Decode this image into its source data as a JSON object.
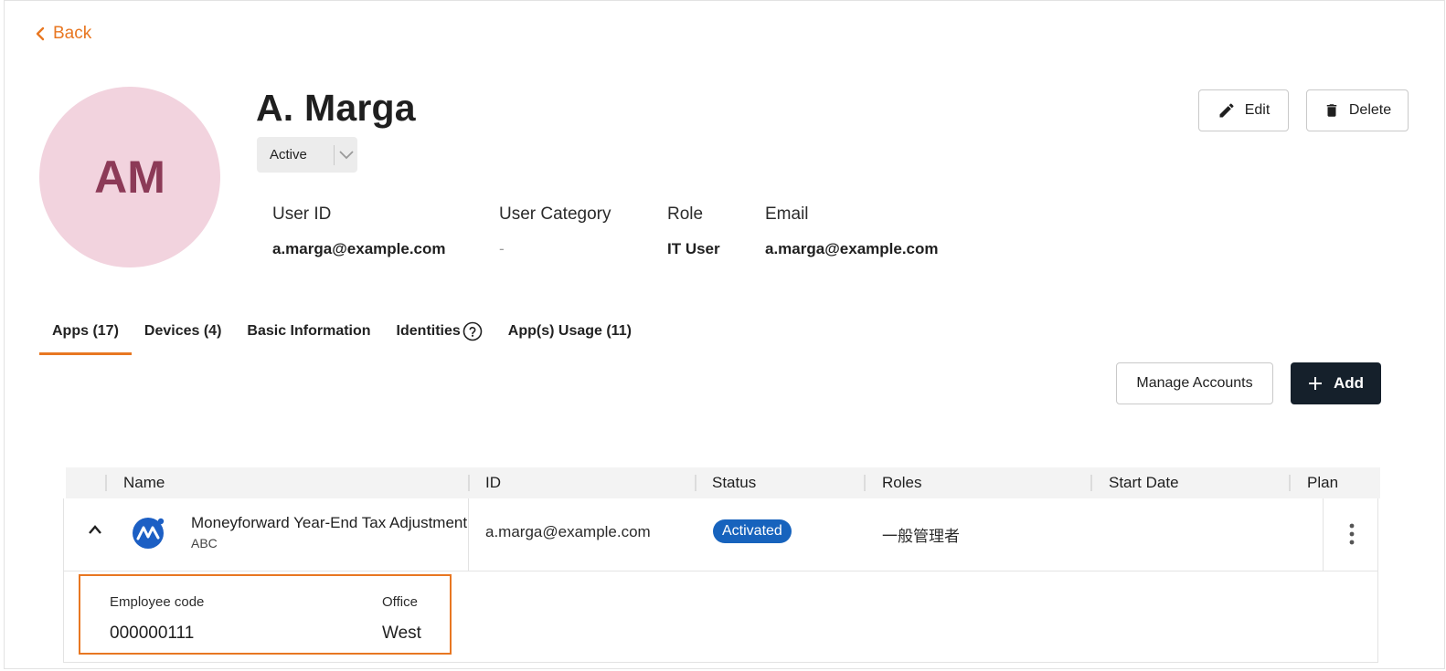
{
  "nav": {
    "back_label": "Back"
  },
  "user": {
    "initials": "AM",
    "name": "A. Marga",
    "status": "Active"
  },
  "actions": {
    "edit_label": "Edit",
    "delete_label": "Delete"
  },
  "info": [
    {
      "label": "User ID",
      "value": "a.marga@example.com"
    },
    {
      "label": "User Category",
      "value": "-"
    },
    {
      "label": "Role",
      "value": "IT User"
    },
    {
      "label": "Email",
      "value": "a.marga@example.com"
    }
  ],
  "tabs": [
    {
      "label": "Apps (17)",
      "active": true
    },
    {
      "label": "Devices (4)"
    },
    {
      "label": "Basic Information"
    },
    {
      "label": "Identities"
    },
    {
      "label": "App(s) Usage (11)"
    }
  ],
  "toolbar": {
    "manage_label": "Manage Accounts",
    "add_label": "Add"
  },
  "table": {
    "columns": [
      "Name",
      "ID",
      "Status",
      "Roles",
      "Start Date",
      "Plan"
    ],
    "rows": [
      {
        "app_name": "Moneyforward Year-End Tax Adjustment",
        "app_sub": "ABC",
        "id": "a.marga@example.com",
        "status": "Activated",
        "roles": "一般管理者",
        "start_date": "",
        "plan": "",
        "details": [
          {
            "label": "Employee code",
            "value": "000000111"
          },
          {
            "label": "Office",
            "value": "West"
          }
        ]
      }
    ]
  },
  "colors": {
    "accent": "#e87722",
    "avatar_bg": "#f2d3de",
    "avatar_text": "#8c3a57",
    "primary_button": "#15202b",
    "status_badge": "#1763bd"
  },
  "icons": [
    "chevron-left-icon",
    "chevron-down-icon",
    "pencil-icon",
    "trash-icon",
    "help-circle-icon",
    "plus-icon",
    "chevron-up-icon",
    "app-logo-icon",
    "kebab-menu-icon"
  ]
}
